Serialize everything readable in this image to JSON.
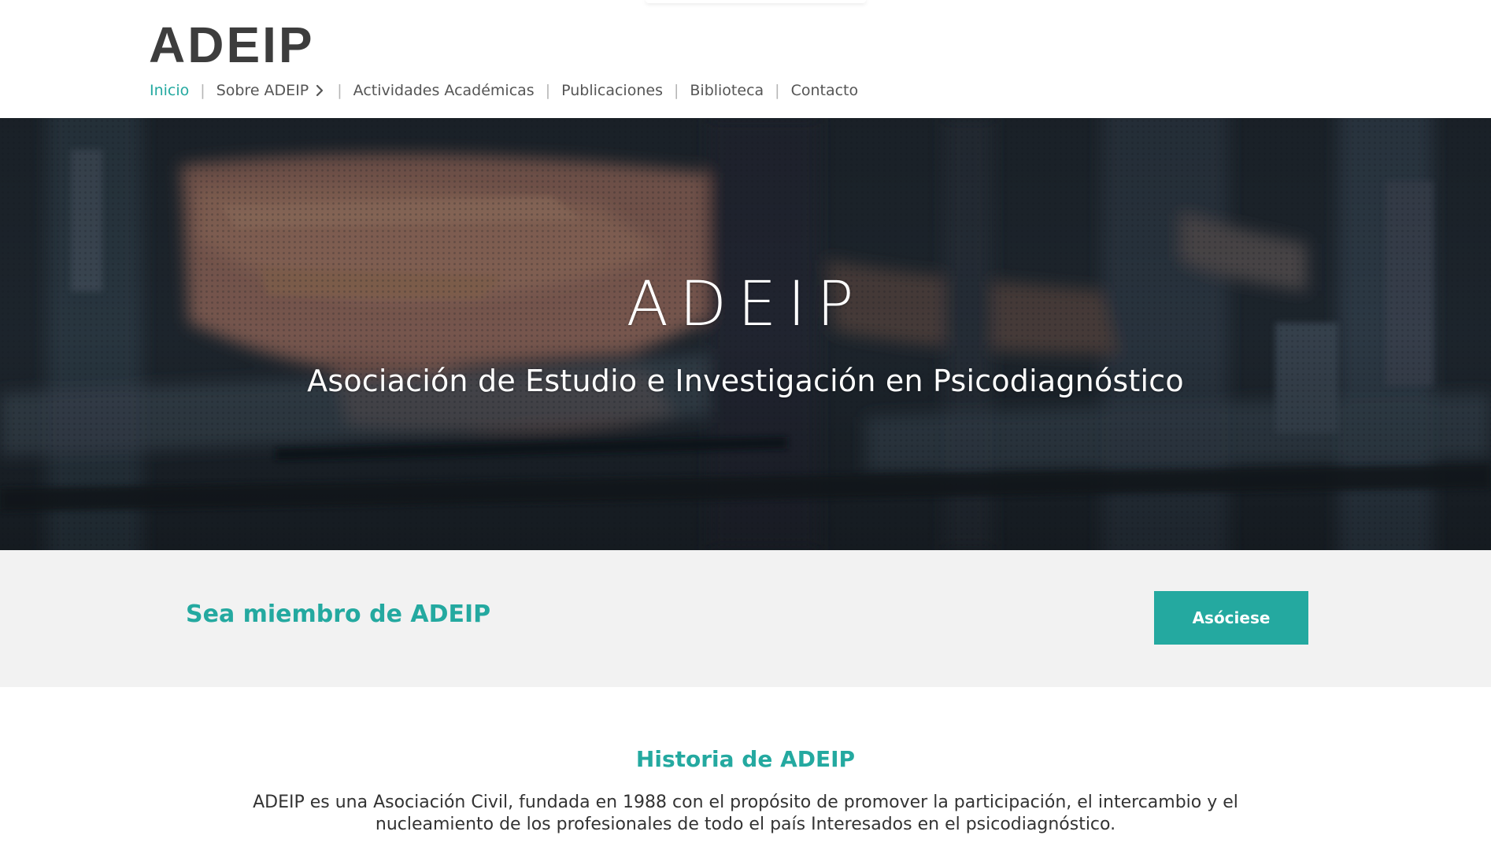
{
  "header": {
    "logo": "ADEIP",
    "nav": [
      {
        "label": "Inicio",
        "active": true
      },
      {
        "label": "Sobre ADEIP",
        "has_submenu": true
      },
      {
        "label": "Actividades Académicas"
      },
      {
        "label": "Publicaciones"
      },
      {
        "label": "Biblioteca"
      },
      {
        "label": "Contacto"
      }
    ],
    "separator": "|"
  },
  "hero": {
    "title": "ADEIP",
    "subtitle": "Asociación de Estudio e Investigación en Psicodiagnóstico"
  },
  "membership": {
    "text": "Sea miembro de ADEIP",
    "button_label": "Asóciese"
  },
  "history": {
    "title": "Historia de ADEIP",
    "body": "ADEIP es una Asociación Civil, fundada en 1988 con el propósito de promover la participación, el intercambio y el nucleamiento de los profesionales de todo el país Interesados en el psicodiagnóstico."
  },
  "colors": {
    "accent": "#24a9a0",
    "band_background": "#f2f2f2",
    "logo": "#3d3d3d"
  },
  "icons": {
    "submenu": "chevron-right-icon"
  }
}
